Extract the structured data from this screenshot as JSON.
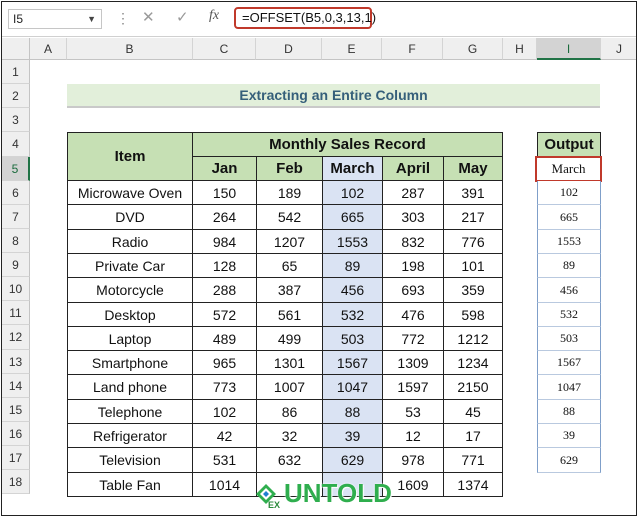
{
  "formula_bar": {
    "name_box": "I5",
    "cancel_icon": "✕",
    "enter_icon": "✓",
    "fx_label": "fx",
    "formula": "=OFFSET(B5,0,3,13,1)"
  },
  "columns": [
    "A",
    "B",
    "C",
    "D",
    "E",
    "F",
    "G",
    "H",
    "I",
    "J"
  ],
  "rows": [
    "1",
    "2",
    "3",
    "4",
    "5",
    "6",
    "7",
    "8",
    "9",
    "10",
    "11",
    "12",
    "13",
    "14",
    "15",
    "16",
    "17",
    "18"
  ],
  "sheet": {
    "title": "Extracting an Entire Column",
    "item_header": "Item",
    "group_header": "Monthly Sales Record",
    "months": [
      "Jan",
      "Feb",
      "March",
      "April",
      "May"
    ],
    "items": [
      {
        "item": "Microwave Oven",
        "values": [
          "150",
          "189",
          "102",
          "287",
          "391"
        ]
      },
      {
        "item": "DVD",
        "values": [
          "264",
          "542",
          "665",
          "303",
          "217"
        ]
      },
      {
        "item": "Radio",
        "values": [
          "984",
          "1207",
          "1553",
          "832",
          "776"
        ]
      },
      {
        "item": "Private Car",
        "values": [
          "128",
          "65",
          "89",
          "198",
          "101"
        ]
      },
      {
        "item": "Motorcycle",
        "values": [
          "288",
          "387",
          "456",
          "693",
          "359"
        ]
      },
      {
        "item": "Desktop",
        "values": [
          "572",
          "561",
          "532",
          "476",
          "598"
        ]
      },
      {
        "item": "Laptop",
        "values": [
          "489",
          "499",
          "503",
          "772",
          "1212"
        ]
      },
      {
        "item": "Smartphone",
        "values": [
          "965",
          "1301",
          "1567",
          "1309",
          "1234"
        ]
      },
      {
        "item": "Land phone",
        "values": [
          "773",
          "1007",
          "1047",
          "1597",
          "2150"
        ]
      },
      {
        "item": "Telephone",
        "values": [
          "102",
          "86",
          "88",
          "53",
          "45"
        ]
      },
      {
        "item": "Refrigerator",
        "values": [
          "42",
          "32",
          "39",
          "12",
          "17"
        ]
      },
      {
        "item": "Television",
        "values": [
          "531",
          "632",
          "629",
          "978",
          "771"
        ]
      },
      {
        "item": "Table Fan",
        "values": [
          "1014",
          "",
          "",
          "1609",
          "1374"
        ]
      }
    ],
    "output_header": "Output",
    "output_values": [
      "March",
      "102",
      "665",
      "1553",
      "89",
      "456",
      "532",
      "503",
      "1567",
      "1047",
      "88",
      "39",
      "629"
    ]
  },
  "watermark": {
    "brand": "UNTOLD",
    "badge": "EX"
  },
  "colors": {
    "header_green": "#c6e0b4",
    "title_green": "#e2efda",
    "march_blue": "#dae3f3",
    "highlight_red": "#c0392b"
  }
}
